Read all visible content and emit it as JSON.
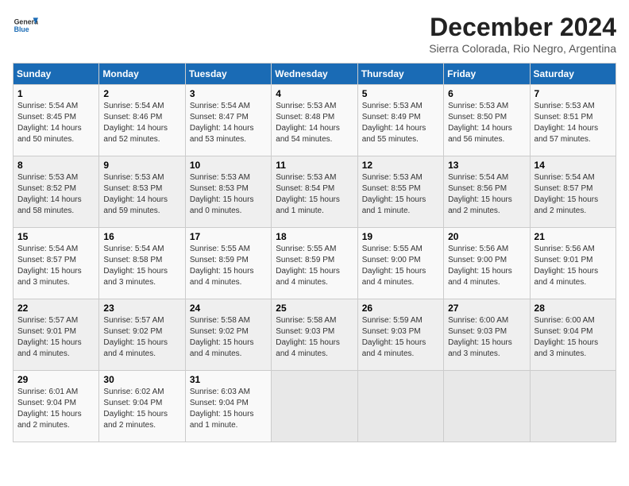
{
  "header": {
    "logo_line1": "General",
    "logo_line2": "Blue",
    "title": "December 2024",
    "subtitle": "Sierra Colorada, Rio Negro, Argentina"
  },
  "columns": [
    "Sunday",
    "Monday",
    "Tuesday",
    "Wednesday",
    "Thursday",
    "Friday",
    "Saturday"
  ],
  "weeks": [
    [
      {
        "day": "1",
        "info": "Sunrise: 5:54 AM\nSunset: 8:45 PM\nDaylight: 14 hours\nand 50 minutes."
      },
      {
        "day": "2",
        "info": "Sunrise: 5:54 AM\nSunset: 8:46 PM\nDaylight: 14 hours\nand 52 minutes."
      },
      {
        "day": "3",
        "info": "Sunrise: 5:54 AM\nSunset: 8:47 PM\nDaylight: 14 hours\nand 53 minutes."
      },
      {
        "day": "4",
        "info": "Sunrise: 5:53 AM\nSunset: 8:48 PM\nDaylight: 14 hours\nand 54 minutes."
      },
      {
        "day": "5",
        "info": "Sunrise: 5:53 AM\nSunset: 8:49 PM\nDaylight: 14 hours\nand 55 minutes."
      },
      {
        "day": "6",
        "info": "Sunrise: 5:53 AM\nSunset: 8:50 PM\nDaylight: 14 hours\nand 56 minutes."
      },
      {
        "day": "7",
        "info": "Sunrise: 5:53 AM\nSunset: 8:51 PM\nDaylight: 14 hours\nand 57 minutes."
      }
    ],
    [
      {
        "day": "8",
        "info": "Sunrise: 5:53 AM\nSunset: 8:52 PM\nDaylight: 14 hours\nand 58 minutes."
      },
      {
        "day": "9",
        "info": "Sunrise: 5:53 AM\nSunset: 8:53 PM\nDaylight: 14 hours\nand 59 minutes."
      },
      {
        "day": "10",
        "info": "Sunrise: 5:53 AM\nSunset: 8:53 PM\nDaylight: 15 hours\nand 0 minutes."
      },
      {
        "day": "11",
        "info": "Sunrise: 5:53 AM\nSunset: 8:54 PM\nDaylight: 15 hours\nand 1 minute."
      },
      {
        "day": "12",
        "info": "Sunrise: 5:53 AM\nSunset: 8:55 PM\nDaylight: 15 hours\nand 1 minute."
      },
      {
        "day": "13",
        "info": "Sunrise: 5:54 AM\nSunset: 8:56 PM\nDaylight: 15 hours\nand 2 minutes."
      },
      {
        "day": "14",
        "info": "Sunrise: 5:54 AM\nSunset: 8:57 PM\nDaylight: 15 hours\nand 2 minutes."
      }
    ],
    [
      {
        "day": "15",
        "info": "Sunrise: 5:54 AM\nSunset: 8:57 PM\nDaylight: 15 hours\nand 3 minutes."
      },
      {
        "day": "16",
        "info": "Sunrise: 5:54 AM\nSunset: 8:58 PM\nDaylight: 15 hours\nand 3 minutes."
      },
      {
        "day": "17",
        "info": "Sunrise: 5:55 AM\nSunset: 8:59 PM\nDaylight: 15 hours\nand 4 minutes."
      },
      {
        "day": "18",
        "info": "Sunrise: 5:55 AM\nSunset: 8:59 PM\nDaylight: 15 hours\nand 4 minutes."
      },
      {
        "day": "19",
        "info": "Sunrise: 5:55 AM\nSunset: 9:00 PM\nDaylight: 15 hours\nand 4 minutes."
      },
      {
        "day": "20",
        "info": "Sunrise: 5:56 AM\nSunset: 9:00 PM\nDaylight: 15 hours\nand 4 minutes."
      },
      {
        "day": "21",
        "info": "Sunrise: 5:56 AM\nSunset: 9:01 PM\nDaylight: 15 hours\nand 4 minutes."
      }
    ],
    [
      {
        "day": "22",
        "info": "Sunrise: 5:57 AM\nSunset: 9:01 PM\nDaylight: 15 hours\nand 4 minutes."
      },
      {
        "day": "23",
        "info": "Sunrise: 5:57 AM\nSunset: 9:02 PM\nDaylight: 15 hours\nand 4 minutes."
      },
      {
        "day": "24",
        "info": "Sunrise: 5:58 AM\nSunset: 9:02 PM\nDaylight: 15 hours\nand 4 minutes."
      },
      {
        "day": "25",
        "info": "Sunrise: 5:58 AM\nSunset: 9:03 PM\nDaylight: 15 hours\nand 4 minutes."
      },
      {
        "day": "26",
        "info": "Sunrise: 5:59 AM\nSunset: 9:03 PM\nDaylight: 15 hours\nand 4 minutes."
      },
      {
        "day": "27",
        "info": "Sunrise: 6:00 AM\nSunset: 9:03 PM\nDaylight: 15 hours\nand 3 minutes."
      },
      {
        "day": "28",
        "info": "Sunrise: 6:00 AM\nSunset: 9:04 PM\nDaylight: 15 hours\nand 3 minutes."
      }
    ],
    [
      {
        "day": "29",
        "info": "Sunrise: 6:01 AM\nSunset: 9:04 PM\nDaylight: 15 hours\nand 2 minutes."
      },
      {
        "day": "30",
        "info": "Sunrise: 6:02 AM\nSunset: 9:04 PM\nDaylight: 15 hours\nand 2 minutes."
      },
      {
        "day": "31",
        "info": "Sunrise: 6:03 AM\nSunset: 9:04 PM\nDaylight: 15 hours\nand 1 minute."
      },
      null,
      null,
      null,
      null
    ]
  ]
}
